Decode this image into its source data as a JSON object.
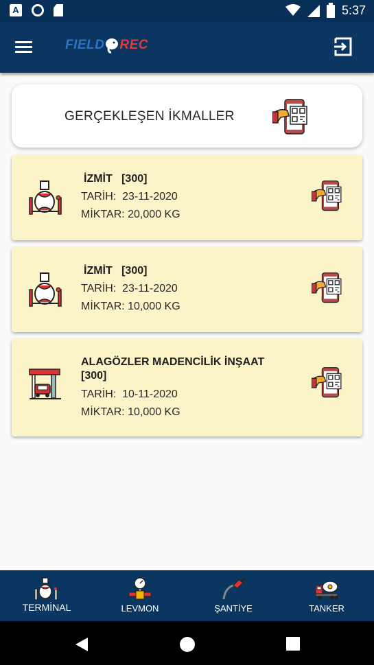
{
  "status_bar": {
    "left_icons": [
      "a-notification-icon",
      "circle-notification-icon",
      "sd-card-icon"
    ],
    "a_glyph": "A",
    "right_icons": [
      "wifi-icon",
      "cellular-signal-icon",
      "battery-icon"
    ],
    "time": "5:37"
  },
  "app_bar": {
    "logo_part1": "FIELD",
    "logo_part2": "REC",
    "menu_icon": "hamburger-menu-icon",
    "logout_icon": "logout-icon"
  },
  "header": {
    "title": "GERÇEKLEŞEN İKMALLER",
    "icon": "mobile-qr-scan-icon"
  },
  "refuels": [
    {
      "icon": "terminal-tank-icon",
      "title": "İZMİT   [300]",
      "date_label": "TARİH:",
      "date": "23-11-2020",
      "amount_label": "MİKTAR:",
      "amount": "20,000 KG",
      "action_icon": "mobile-qr-scan-icon"
    },
    {
      "icon": "terminal-tank-icon",
      "title": "İZMİT   [300]",
      "date_label": "TARİH:",
      "date": "23-11-2020",
      "amount_label": "MİKTAR:",
      "amount": "10,000 KG",
      "action_icon": "mobile-qr-scan-icon"
    },
    {
      "icon": "gas-station-icon",
      "title": "ALAGÖZLER MADENCİLİK İNŞAAT [300]",
      "date_label": "TARİH:",
      "date": "10-11-2020",
      "amount_label": "MİKTAR:",
      "amount": "10,000 KG",
      "action_icon": "mobile-qr-scan-icon"
    }
  ],
  "bottom_nav": [
    {
      "label": "TERMİNAL",
      "icon": "terminal-tank-icon",
      "active": true
    },
    {
      "label": "LEVMON",
      "icon": "pressure-gauge-icon",
      "active": false
    },
    {
      "label": "ŞANTİYE",
      "icon": "fuel-nozzle-icon",
      "active": false
    },
    {
      "label": "TANKER",
      "icon": "tanker-truck-icon",
      "active": false
    }
  ],
  "system_nav": [
    "back-icon",
    "home-icon",
    "recents-icon"
  ],
  "colors": {
    "primary": "#0b3661",
    "status_bar": "#082f57",
    "card_background": "#fbf4c8",
    "accent_red": "#e23a3a",
    "accent_blue": "#2f74c4"
  }
}
